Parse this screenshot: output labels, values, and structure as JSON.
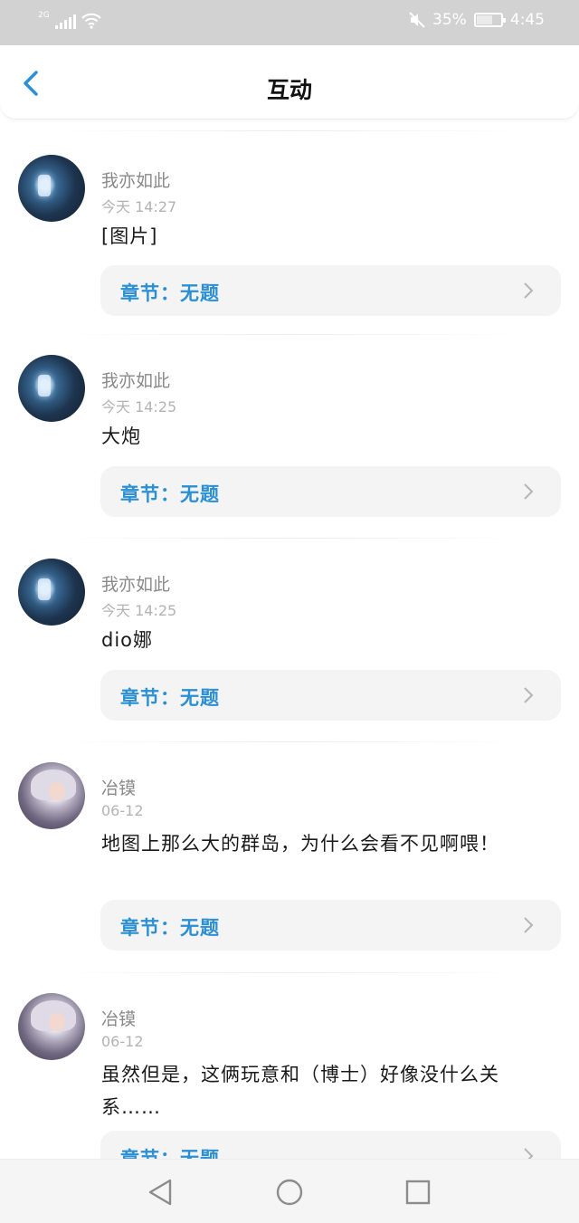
{
  "status_bar": {
    "network": "2G",
    "battery": "35%",
    "time": "4:45"
  },
  "header": {
    "title": "互动",
    "back_icon": "back-chevron-icon"
  },
  "posts": [
    {
      "user": "我亦如此",
      "time": "今天 14:27",
      "content": "[图片]",
      "chapter": "章节：无题"
    },
    {
      "user": "我亦如此",
      "time": "今天 14:25",
      "content": "大炮",
      "chapter": "章节：无题"
    },
    {
      "user": "我亦如此",
      "time": "今天 14:25",
      "content": "dio娜",
      "chapter": "章节：无题"
    },
    {
      "user": "冶镆",
      "time": "06-12",
      "content": "地图上那么大的群岛，为什么会看不见啊喂！",
      "chapter": "章节：无题"
    },
    {
      "user": "冶镆",
      "time": "06-12",
      "content": "虽然但是，这俩玩意和（博士）好像没什么关系……",
      "chapter": "章节：无题"
    }
  ],
  "colors": {
    "accent": "#2b8fd4",
    "status_bar_bg": "#d2d2d2",
    "chapter_bg": "#f4f4f4"
  }
}
